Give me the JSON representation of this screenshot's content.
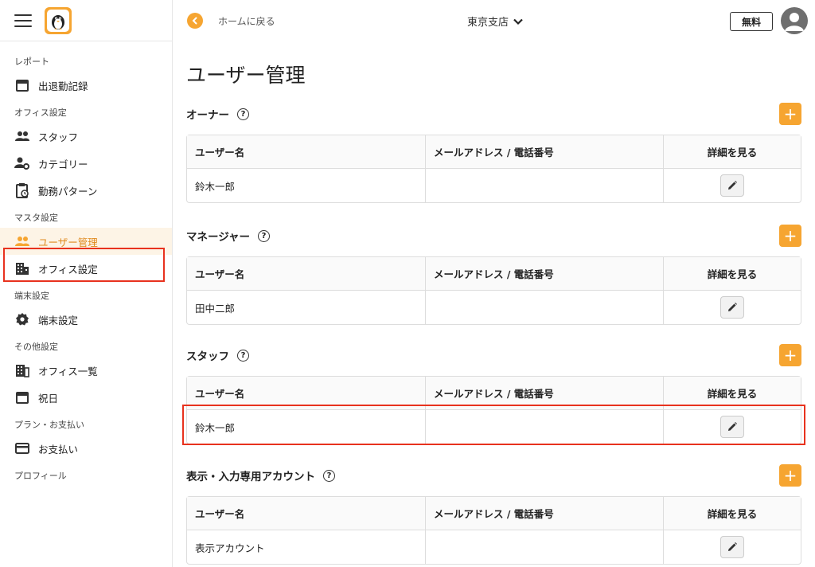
{
  "header": {
    "back_label": "ホームに戻る",
    "branch": "東京支店",
    "free_label": "無料"
  },
  "sidebar": {
    "sections": [
      {
        "title": "レポート",
        "items": [
          {
            "label": "出退勤記録",
            "icon": "calendar-icon"
          }
        ]
      },
      {
        "title": "オフィス設定",
        "items": [
          {
            "label": "スタッフ",
            "icon": "people-icon"
          },
          {
            "label": "カテゴリー",
            "icon": "person-gear-icon"
          },
          {
            "label": "勤務パターン",
            "icon": "clipboard-clock-icon"
          }
        ]
      },
      {
        "title": "マスタ設定",
        "items": [
          {
            "label": "ユーザー管理",
            "icon": "people-icon",
            "active": true
          },
          {
            "label": "オフィス設定",
            "icon": "building-icon"
          }
        ]
      },
      {
        "title": "端末設定",
        "items": [
          {
            "label": "端末設定",
            "icon": "gear-icon"
          }
        ]
      },
      {
        "title": "その他設定",
        "items": [
          {
            "label": "オフィス一覧",
            "icon": "office-list-icon"
          },
          {
            "label": "祝日",
            "icon": "calendar-icon"
          }
        ]
      },
      {
        "title": "プラン・お支払い",
        "items": [
          {
            "label": "お支払い",
            "icon": "credit-card-icon"
          }
        ]
      },
      {
        "title": "プロフィール",
        "items": []
      }
    ]
  },
  "main": {
    "title": "ユーザー管理",
    "columns": [
      "ユーザー名",
      "メールアドレス / 電話番号",
      "詳細を見る"
    ],
    "sections": [
      {
        "title": "オーナー",
        "rows": [
          {
            "name": "鈴木一郎",
            "contact": ""
          }
        ]
      },
      {
        "title": "マネージャー",
        "rows": [
          {
            "name": "田中二郎",
            "contact": ""
          }
        ]
      },
      {
        "title": "スタッフ",
        "rows": [
          {
            "name": "鈴木一郎",
            "contact": ""
          }
        ]
      },
      {
        "title": "表示・入力専用アカウント",
        "rows": [
          {
            "name": "表示アカウント",
            "contact": ""
          }
        ]
      }
    ]
  },
  "colors": {
    "accent": "#f6a531",
    "highlight": "#e8321e"
  }
}
